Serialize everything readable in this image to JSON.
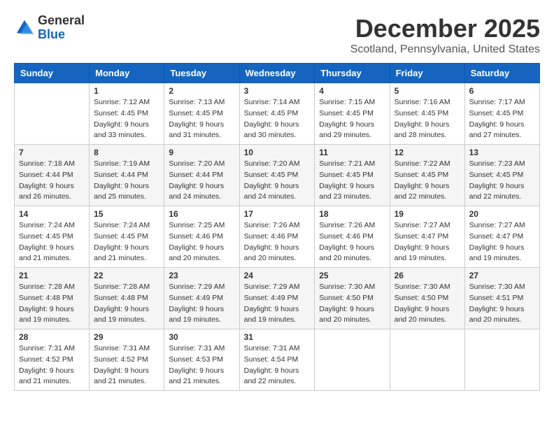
{
  "header": {
    "logo_general": "General",
    "logo_blue": "Blue",
    "month": "December 2025",
    "location": "Scotland, Pennsylvania, United States"
  },
  "days_of_week": [
    "Sunday",
    "Monday",
    "Tuesday",
    "Wednesday",
    "Thursday",
    "Friday",
    "Saturday"
  ],
  "weeks": [
    [
      {
        "day": "",
        "sunrise": "",
        "sunset": "",
        "daylight": ""
      },
      {
        "day": "1",
        "sunrise": "Sunrise: 7:12 AM",
        "sunset": "Sunset: 4:45 PM",
        "daylight": "Daylight: 9 hours and 33 minutes."
      },
      {
        "day": "2",
        "sunrise": "Sunrise: 7:13 AM",
        "sunset": "Sunset: 4:45 PM",
        "daylight": "Daylight: 9 hours and 31 minutes."
      },
      {
        "day": "3",
        "sunrise": "Sunrise: 7:14 AM",
        "sunset": "Sunset: 4:45 PM",
        "daylight": "Daylight: 9 hours and 30 minutes."
      },
      {
        "day": "4",
        "sunrise": "Sunrise: 7:15 AM",
        "sunset": "Sunset: 4:45 PM",
        "daylight": "Daylight: 9 hours and 29 minutes."
      },
      {
        "day": "5",
        "sunrise": "Sunrise: 7:16 AM",
        "sunset": "Sunset: 4:45 PM",
        "daylight": "Daylight: 9 hours and 28 minutes."
      },
      {
        "day": "6",
        "sunrise": "Sunrise: 7:17 AM",
        "sunset": "Sunset: 4:45 PM",
        "daylight": "Daylight: 9 hours and 27 minutes."
      }
    ],
    [
      {
        "day": "7",
        "sunrise": "Sunrise: 7:18 AM",
        "sunset": "Sunset: 4:44 PM",
        "daylight": "Daylight: 9 hours and 26 minutes."
      },
      {
        "day": "8",
        "sunrise": "Sunrise: 7:19 AM",
        "sunset": "Sunset: 4:44 PM",
        "daylight": "Daylight: 9 hours and 25 minutes."
      },
      {
        "day": "9",
        "sunrise": "Sunrise: 7:20 AM",
        "sunset": "Sunset: 4:44 PM",
        "daylight": "Daylight: 9 hours and 24 minutes."
      },
      {
        "day": "10",
        "sunrise": "Sunrise: 7:20 AM",
        "sunset": "Sunset: 4:45 PM",
        "daylight": "Daylight: 9 hours and 24 minutes."
      },
      {
        "day": "11",
        "sunrise": "Sunrise: 7:21 AM",
        "sunset": "Sunset: 4:45 PM",
        "daylight": "Daylight: 9 hours and 23 minutes."
      },
      {
        "day": "12",
        "sunrise": "Sunrise: 7:22 AM",
        "sunset": "Sunset: 4:45 PM",
        "daylight": "Daylight: 9 hours and 22 minutes."
      },
      {
        "day": "13",
        "sunrise": "Sunrise: 7:23 AM",
        "sunset": "Sunset: 4:45 PM",
        "daylight": "Daylight: 9 hours and 22 minutes."
      }
    ],
    [
      {
        "day": "14",
        "sunrise": "Sunrise: 7:24 AM",
        "sunset": "Sunset: 4:45 PM",
        "daylight": "Daylight: 9 hours and 21 minutes."
      },
      {
        "day": "15",
        "sunrise": "Sunrise: 7:24 AM",
        "sunset": "Sunset: 4:45 PM",
        "daylight": "Daylight: 9 hours and 21 minutes."
      },
      {
        "day": "16",
        "sunrise": "Sunrise: 7:25 AM",
        "sunset": "Sunset: 4:46 PM",
        "daylight": "Daylight: 9 hours and 20 minutes."
      },
      {
        "day": "17",
        "sunrise": "Sunrise: 7:26 AM",
        "sunset": "Sunset: 4:46 PM",
        "daylight": "Daylight: 9 hours and 20 minutes."
      },
      {
        "day": "18",
        "sunrise": "Sunrise: 7:26 AM",
        "sunset": "Sunset: 4:46 PM",
        "daylight": "Daylight: 9 hours and 20 minutes."
      },
      {
        "day": "19",
        "sunrise": "Sunrise: 7:27 AM",
        "sunset": "Sunset: 4:47 PM",
        "daylight": "Daylight: 9 hours and 19 minutes."
      },
      {
        "day": "20",
        "sunrise": "Sunrise: 7:27 AM",
        "sunset": "Sunset: 4:47 PM",
        "daylight": "Daylight: 9 hours and 19 minutes."
      }
    ],
    [
      {
        "day": "21",
        "sunrise": "Sunrise: 7:28 AM",
        "sunset": "Sunset: 4:48 PM",
        "daylight": "Daylight: 9 hours and 19 minutes."
      },
      {
        "day": "22",
        "sunrise": "Sunrise: 7:28 AM",
        "sunset": "Sunset: 4:48 PM",
        "daylight": "Daylight: 9 hours and 19 minutes."
      },
      {
        "day": "23",
        "sunrise": "Sunrise: 7:29 AM",
        "sunset": "Sunset: 4:49 PM",
        "daylight": "Daylight: 9 hours and 19 minutes."
      },
      {
        "day": "24",
        "sunrise": "Sunrise: 7:29 AM",
        "sunset": "Sunset: 4:49 PM",
        "daylight": "Daylight: 9 hours and 19 minutes."
      },
      {
        "day": "25",
        "sunrise": "Sunrise: 7:30 AM",
        "sunset": "Sunset: 4:50 PM",
        "daylight": "Daylight: 9 hours and 20 minutes."
      },
      {
        "day": "26",
        "sunrise": "Sunrise: 7:30 AM",
        "sunset": "Sunset: 4:50 PM",
        "daylight": "Daylight: 9 hours and 20 minutes."
      },
      {
        "day": "27",
        "sunrise": "Sunrise: 7:30 AM",
        "sunset": "Sunset: 4:51 PM",
        "daylight": "Daylight: 9 hours and 20 minutes."
      }
    ],
    [
      {
        "day": "28",
        "sunrise": "Sunrise: 7:31 AM",
        "sunset": "Sunset: 4:52 PM",
        "daylight": "Daylight: 9 hours and 21 minutes."
      },
      {
        "day": "29",
        "sunrise": "Sunrise: 7:31 AM",
        "sunset": "Sunset: 4:52 PM",
        "daylight": "Daylight: 9 hours and 21 minutes."
      },
      {
        "day": "30",
        "sunrise": "Sunrise: 7:31 AM",
        "sunset": "Sunset: 4:53 PM",
        "daylight": "Daylight: 9 hours and 21 minutes."
      },
      {
        "day": "31",
        "sunrise": "Sunrise: 7:31 AM",
        "sunset": "Sunset: 4:54 PM",
        "daylight": "Daylight: 9 hours and 22 minutes."
      },
      {
        "day": "",
        "sunrise": "",
        "sunset": "",
        "daylight": ""
      },
      {
        "day": "",
        "sunrise": "",
        "sunset": "",
        "daylight": ""
      },
      {
        "day": "",
        "sunrise": "",
        "sunset": "",
        "daylight": ""
      }
    ]
  ]
}
